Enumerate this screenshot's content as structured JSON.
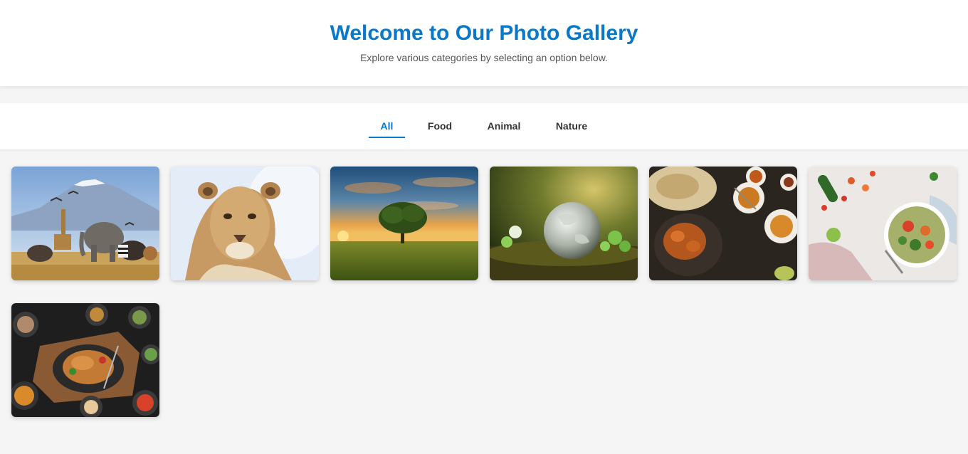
{
  "header": {
    "title": "Welcome to Our Photo Gallery",
    "subtitle": "Explore various categories by selecting an option below."
  },
  "filters": {
    "active": "All",
    "tabs": [
      "All",
      "Food",
      "Animal",
      "Nature"
    ]
  },
  "gallery": {
    "photos": [
      {
        "subject": "African animals with Kilimanjaro",
        "category": "Animal"
      },
      {
        "subject": "Lioness portrait",
        "category": "Animal"
      },
      {
        "subject": "Lone tree at sunset",
        "category": "Nature"
      },
      {
        "subject": "Glass globe on moss",
        "category": "Nature"
      },
      {
        "subject": "Indian dishes and naan",
        "category": "Food"
      },
      {
        "subject": "Salad bowl with vegetables",
        "category": "Food"
      },
      {
        "subject": "Roast chicken dinner spread",
        "category": "Food"
      }
    ]
  },
  "colors": {
    "accent": "#0a78c8",
    "background": "#f5f5f5",
    "surface": "#ffffff"
  }
}
